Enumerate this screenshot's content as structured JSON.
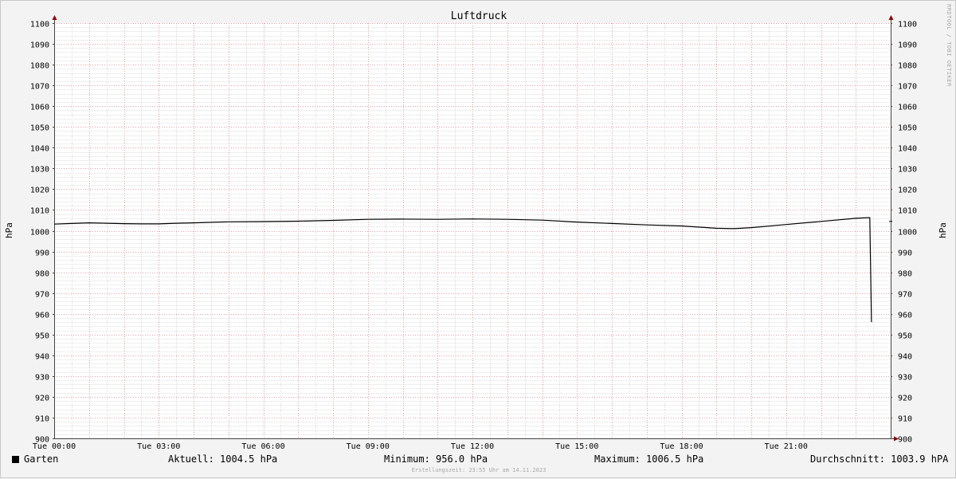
{
  "chart_data": {
    "type": "line",
    "title": "Luftdruck",
    "ylabel": "hPa",
    "ylim": [
      900,
      1100
    ],
    "y_ticks": [
      900,
      910,
      920,
      930,
      940,
      950,
      960,
      970,
      980,
      990,
      1000,
      1010,
      1020,
      1030,
      1040,
      1050,
      1060,
      1070,
      1080,
      1090,
      1100
    ],
    "xlim_hours": [
      0,
      24
    ],
    "x_ticks": [
      {
        "hour": 0,
        "label": "Tue 00:00"
      },
      {
        "hour": 3,
        "label": "Tue 03:00"
      },
      {
        "hour": 6,
        "label": "Tue 06:00"
      },
      {
        "hour": 9,
        "label": "Tue 09:00"
      },
      {
        "hour": 12,
        "label": "Tue 12:00"
      },
      {
        "hour": 15,
        "label": "Tue 15:00"
      },
      {
        "hour": 18,
        "label": "Tue 18:00"
      },
      {
        "hour": 21,
        "label": "Tue 21:00"
      }
    ],
    "grid": true,
    "series": [
      {
        "name": "Garten",
        "color": "#000000",
        "x": [
          0,
          0.5,
          1.0,
          1.5,
          2.0,
          2.5,
          3.0,
          3.5,
          4.0,
          5.0,
          6.0,
          7.0,
          8.0,
          9.0,
          10.0,
          11.0,
          12.0,
          13.0,
          14.0,
          15.0,
          16.0,
          17.0,
          18.0,
          19.0,
          19.5,
          20.0,
          21.0,
          22.0,
          23.0,
          23.35,
          23.4,
          23.45
        ],
        "y": [
          1003.2,
          1003.5,
          1003.8,
          1003.6,
          1003.4,
          1003.3,
          1003.3,
          1003.6,
          1003.8,
          1004.3,
          1004.4,
          1004.6,
          1005.0,
          1005.5,
          1005.6,
          1005.5,
          1005.7,
          1005.5,
          1005.1,
          1004.2,
          1003.5,
          1002.8,
          1002.3,
          1001.2,
          1001.0,
          1001.5,
          1003.0,
          1004.5,
          1006.0,
          1006.3,
          1006.3,
          956.0
        ]
      }
    ]
  },
  "legend": {
    "series_name": "Garten",
    "current": "Aktuell: 1004.5 hPa",
    "minimum": "Minimum: 956.0 hPa",
    "maximum": "Maximum: 1006.5 hPa",
    "average": "Durchschnitt: 1003.9 hPA"
  },
  "footer": "Erstellungszeit: 23:55 Uhr am 14.11.2023",
  "watermark": "RRDTOOL / TOBI OETIKER"
}
